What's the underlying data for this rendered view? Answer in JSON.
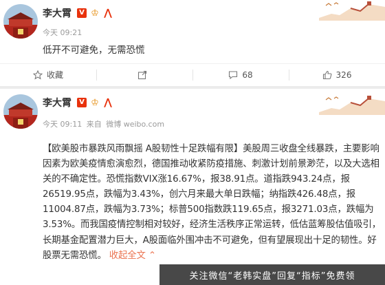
{
  "colors": {
    "accent": "#eb7350",
    "badge_red": "#e8320d",
    "crown": "#e58c0e",
    "meta_gray": "#9a9a9a"
  },
  "posts": [
    {
      "author": "李大霄",
      "timestamp": "今天 09:21",
      "text": "低开不可避免，无需恐慌",
      "actions": [
        {
          "icon": "star-icon",
          "label": "收藏"
        },
        {
          "icon": "share-icon",
          "label": ""
        },
        {
          "icon": "comment-icon",
          "label": "68"
        },
        {
          "icon": "like-icon",
          "label": "326"
        }
      ]
    },
    {
      "author": "李大霄",
      "timestamp": "今天 09:11",
      "source_prefix": "来自",
      "source": "微博 weibo.com",
      "body": "【欧美股市暴跌风雨飘摇 A股韧性十足跌幅有限】美股周三收盘全线暴跌，主要影响因素为欧美疫情愈演愈烈，德国推动收紧防疫措施、刺激计划前景渺茫，以及大选相关的不确定性。恐慌指数VIX涨16.67%，报38.91点。道指跌943.24点，报26519.95点，跌幅为3.43%，创六月来最大单日跌幅；纳指跌426.48点，报11004.87点，跌幅为3.73%；标普500指数跌119.65点，报3271.03点，跌幅为3.53%。而我国疫情控制相对较好，经济生活秩序正常运转，低估蓝筹股估值吸引，长期基金配置潜力巨大，A股面临外围冲击不可避免，但有望展现出十足的韧性。好股票无需恐慌。",
      "expand_label": "收起全文",
      "expand_icon": "chevron-up-icon"
    }
  ],
  "watermark": "关注微信“老韩实盘”回复“指标”免费领"
}
